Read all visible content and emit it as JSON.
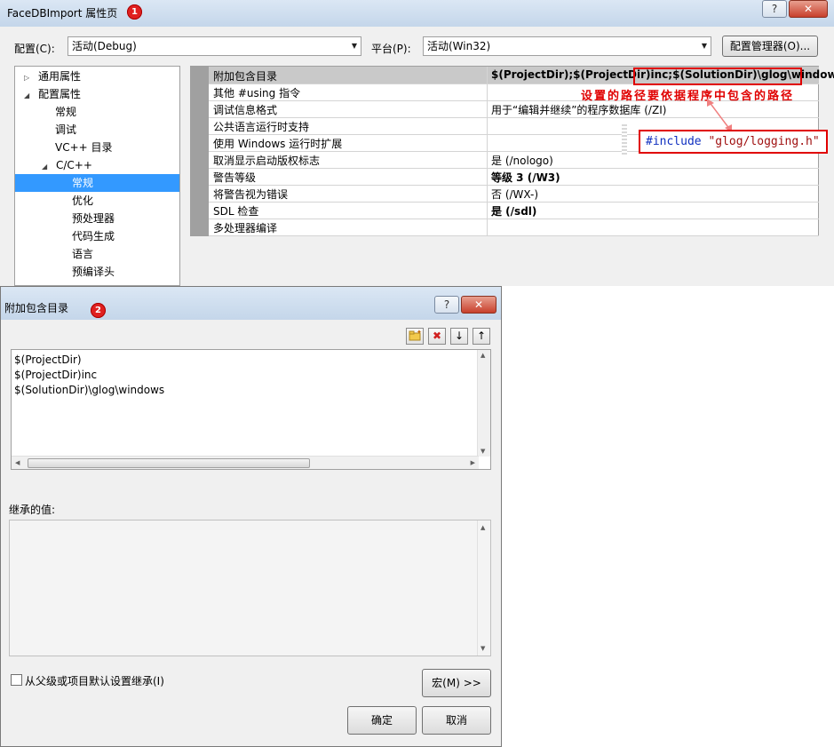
{
  "window1": {
    "title": "FaceDBImport 属性页",
    "badge": "1",
    "help_label": "?",
    "close_label": "✕",
    "config_label": "配置(C):",
    "config_value": "活动(Debug)",
    "platform_label": "平台(P):",
    "platform_value": "活动(Win32)",
    "config_manager_label": "配置管理器(O)...",
    "tree": [
      {
        "label": "通用属性",
        "expander": "▷"
      },
      {
        "label": "配置属性",
        "expander": "◢"
      },
      {
        "label": "常规"
      },
      {
        "label": "调试"
      },
      {
        "label": "VC++ 目录"
      },
      {
        "label": "C/C++",
        "expander": "◢"
      },
      {
        "label": "常规"
      },
      {
        "label": "优化"
      },
      {
        "label": "预处理器"
      },
      {
        "label": "代码生成"
      },
      {
        "label": "语言"
      },
      {
        "label": "预编译头"
      }
    ],
    "grid": [
      {
        "key": "附加包含目录",
        "value": "$(ProjectDir);$(ProjectDir)inc;$(SolutionDir)\\glog\\windows"
      },
      {
        "key": "其他 #using 指令",
        "value": ""
      },
      {
        "key": "调试信息格式",
        "value": "用于“编辑并继续”的程序数据库 (/ZI)"
      },
      {
        "key": "公共语言运行时支持",
        "value": ""
      },
      {
        "key": "使用 Windows 运行时扩展",
        "value": ""
      },
      {
        "key": "取消显示启动版权标志",
        "value": "是 (/nologo)"
      },
      {
        "key": "警告等级",
        "value": "等级 3 (/W3)"
      },
      {
        "key": "将警告视为错误",
        "value": "否 (/WX-)"
      },
      {
        "key": "SDL 检查",
        "value": "是 (/sdl)"
      },
      {
        "key": "多处理器编译",
        "value": ""
      }
    ],
    "annotation": "设置的路径要依据程序中包含的路径",
    "code_keyword": "#include",
    "code_string": "\"glog/logging.h\""
  },
  "window2": {
    "title": "附加包含目录",
    "badge": "2",
    "help_label": "?",
    "close_label": "✕",
    "toolbar": {
      "new_icon": "folder-new-icon",
      "delete_icon": "delete-icon",
      "down_icon": "arrow-down-icon",
      "up_icon": "arrow-up-icon"
    },
    "list": [
      "$(ProjectDir)",
      "$(ProjectDir)inc",
      "$(SolutionDir)\\glog\\windows"
    ],
    "inherited_label": "继承的值:",
    "inherit_checkbox_label": "从父级或项目默认设置继承(I)",
    "macros_label": "宏(M) >>",
    "ok_label": "确定",
    "cancel_label": "取消"
  },
  "colors": {
    "accent_red": "#e00000",
    "selection_blue": "#3399ff"
  }
}
